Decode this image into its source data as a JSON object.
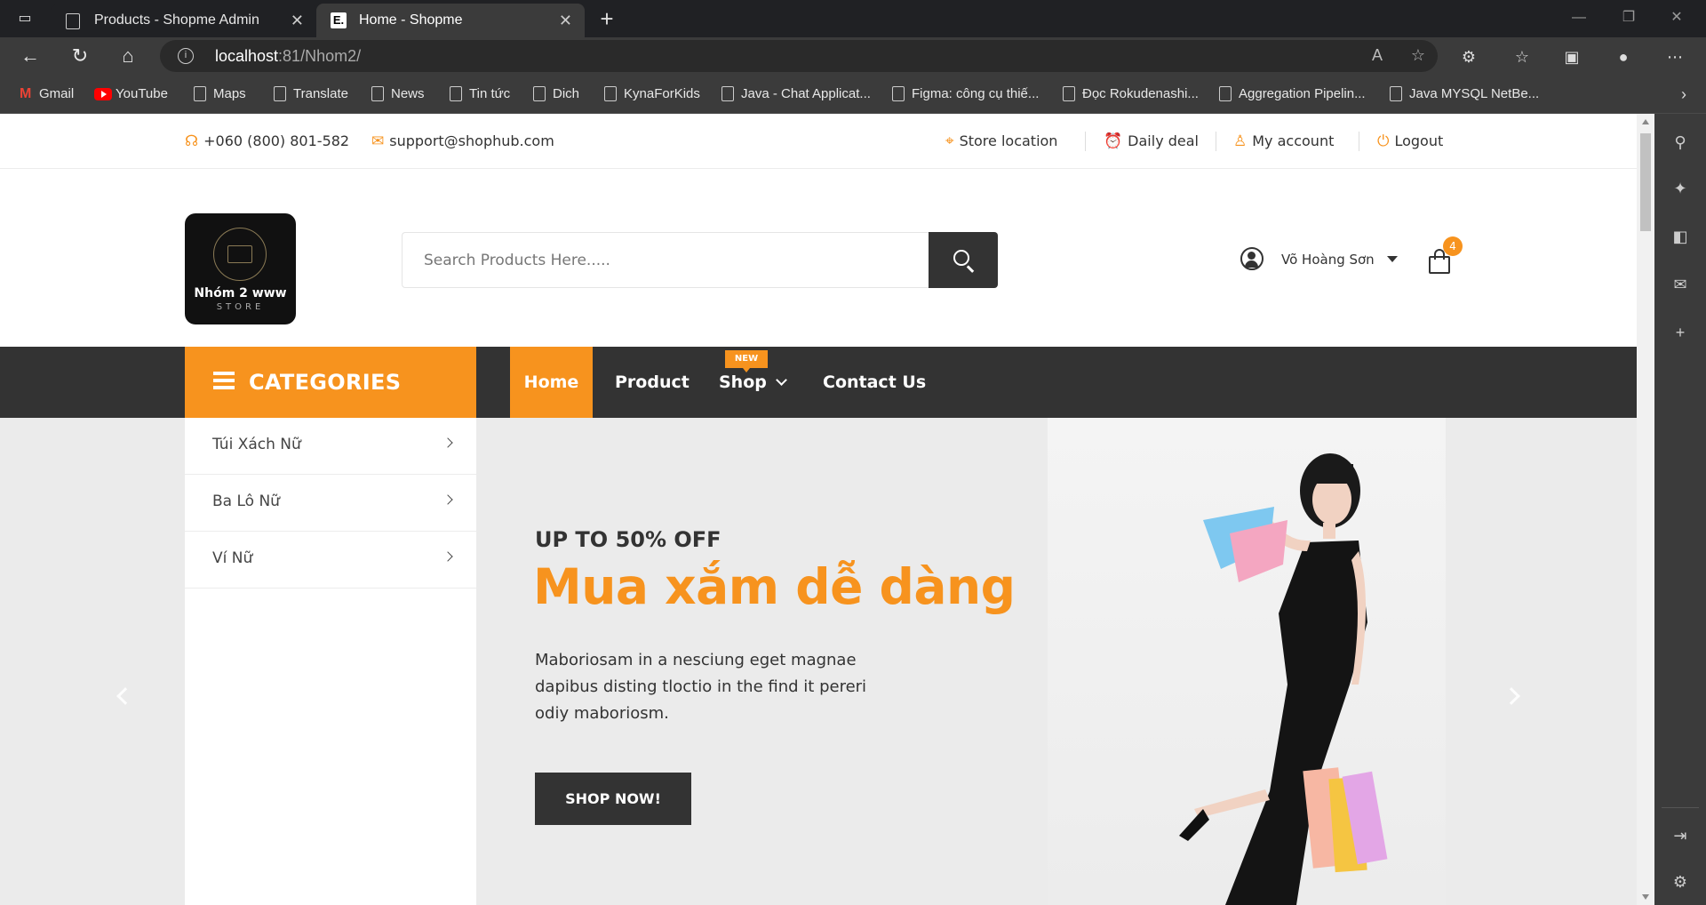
{
  "browser": {
    "tabs": [
      {
        "title": "Products - Shopme Admin",
        "active": false
      },
      {
        "title": "Home - Shopme",
        "active": true
      }
    ],
    "url_host": "localhost",
    "url_rest": ":81/Nhom2/",
    "bookmarks": [
      "Gmail",
      "YouTube",
      "Maps",
      "Translate",
      "News",
      "Tin tức",
      "Dich",
      "KynaForKids",
      "Java - Chat Applicat...",
      "Figma: công cụ thiế...",
      "Đọc Rokudenashi...",
      "Aggregation Pipelin...",
      "Java MYSQL NetBe..."
    ]
  },
  "topbar": {
    "phone": "+060 (800) 801-582",
    "email": "support@shophub.com",
    "links": [
      "Store location",
      "Daily deal",
      "My account",
      "Logout"
    ]
  },
  "header": {
    "logo_name": "Nhóm 2 www",
    "logo_sub": "STORE",
    "search_placeholder": "Search Products Here.....",
    "user_name": "Võ Hoàng Sơn",
    "cart_count": "4"
  },
  "nav": {
    "categories_title": "CATEGORIES",
    "items": [
      "Home",
      "Product",
      "Shop",
      "Contact Us"
    ],
    "new_badge": "NEW"
  },
  "categories": [
    "Túi Xách Nữ",
    "Ba Lô Nữ",
    "Ví Nữ"
  ],
  "hero": {
    "subtitle": "UP TO 50% OFF",
    "title": "Mua xắm dễ dàng",
    "description": "Maboriosam in a nesciung eget magnae dapibus disting tloctio in the find it pereri odiy maboriosm.",
    "button": "SHOP NOW!"
  },
  "colors": {
    "accent": "#f7931e",
    "dark": "#333333",
    "hero_bg": "#ebebeb"
  }
}
